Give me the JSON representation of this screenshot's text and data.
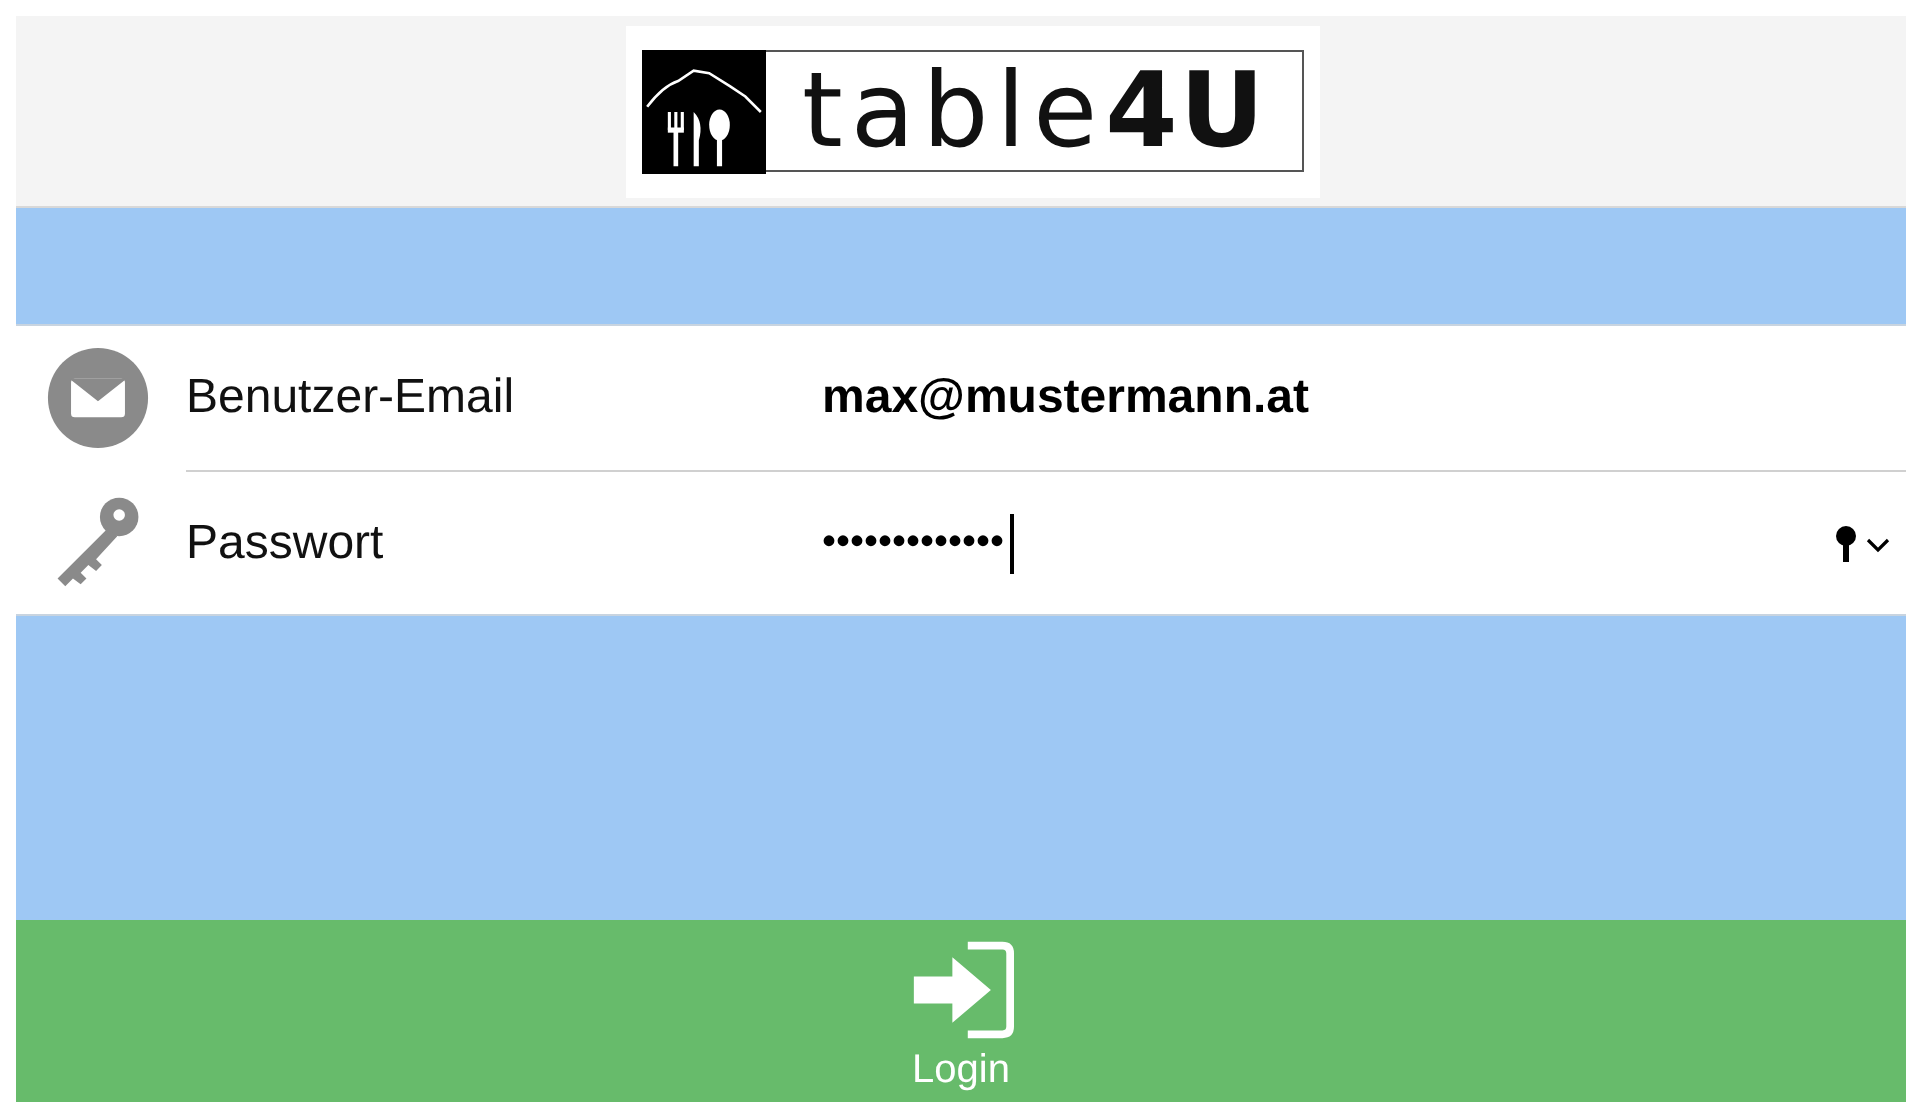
{
  "logo": {
    "text": "table**4U**"
  },
  "fields": [
    {
      "kind": "email",
      "label": "Benutzer-Email",
      "value": "max@mustermann.at",
      "focused": false
    },
    {
      "kind": "password",
      "label": "Passwort",
      "value": "•••••••••••••",
      "focused": true
    }
  ],
  "login_button": {
    "label": "Login"
  }
}
